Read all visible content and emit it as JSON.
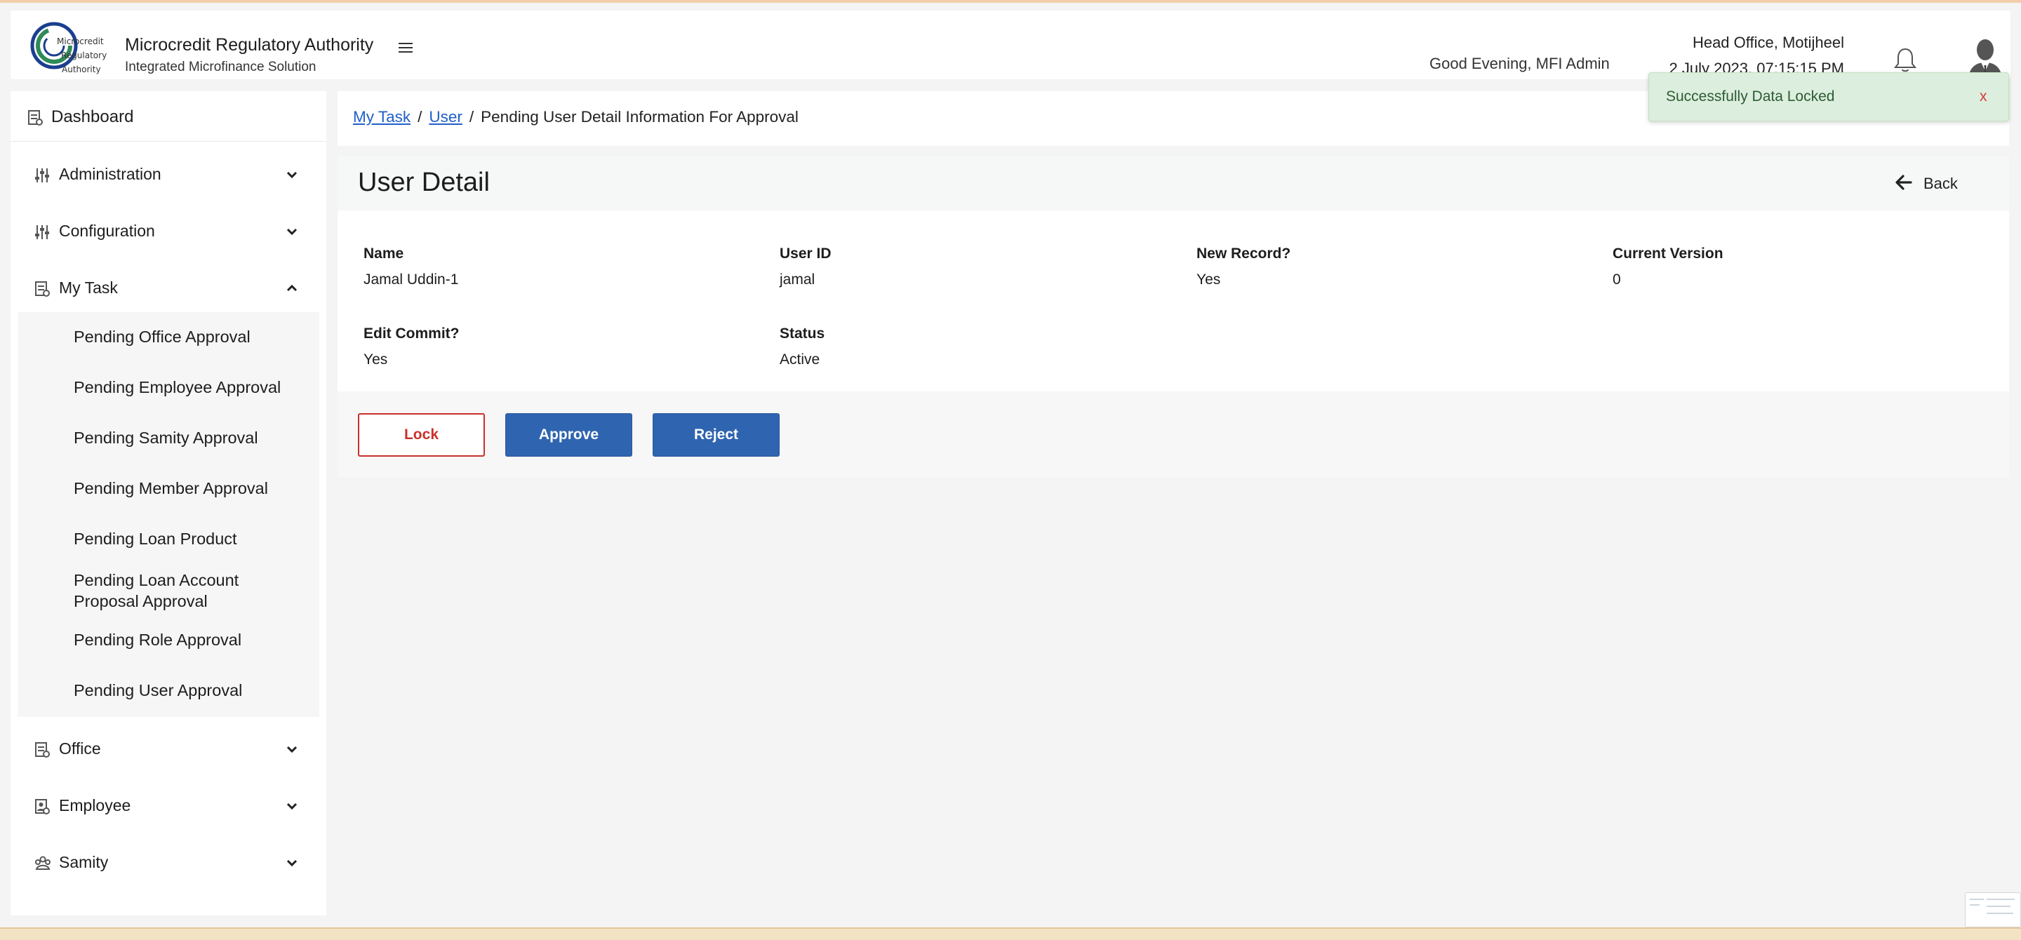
{
  "header": {
    "org_name": "Microcredit Regulatory Authority",
    "org_subtitle": "Integrated Microfinance Solution",
    "logo_text_1": "Microcredit",
    "logo_text_2": "Regulatory",
    "logo_text_3": "Authority",
    "greeting": "Good Evening, MFI Admin",
    "office": "Head Office, Motijheel",
    "datetime": "2 July 2023, 07:15:15 PM"
  },
  "sidebar": {
    "dashboard": "Dashboard",
    "items": [
      {
        "label": "Administration",
        "icon": "sliders-icon",
        "expanded": false
      },
      {
        "label": "Configuration",
        "icon": "sliders-icon",
        "expanded": false
      },
      {
        "label": "My Task",
        "icon": "task-icon",
        "expanded": true
      },
      {
        "label": "Office",
        "icon": "office-icon",
        "expanded": false
      },
      {
        "label": "Employee",
        "icon": "employee-icon",
        "expanded": false
      },
      {
        "label": "Samity",
        "icon": "samity-icon",
        "expanded": false
      }
    ],
    "my_task_sub": [
      "Pending Office Approval",
      "Pending Employee Approval",
      "Pending Samity Approval",
      "Pending Member Approval",
      "Pending Loan Product",
      "Pending Loan Account Proposal Approval",
      "Pending Role Approval",
      "Pending User Approval"
    ]
  },
  "breadcrumb": {
    "items": [
      "My Task",
      "User"
    ],
    "current": "Pending User Detail Information For Approval",
    "separator": "/"
  },
  "detail": {
    "title": "User Detail",
    "back_label": "Back",
    "fields": [
      {
        "label": "Name",
        "value": "Jamal Uddin-1"
      },
      {
        "label": "User ID",
        "value": "jamal"
      },
      {
        "label": "New Record?",
        "value": "Yes"
      },
      {
        "label": "Current Version",
        "value": "0"
      },
      {
        "label": "Edit Commit?",
        "value": "Yes"
      },
      {
        "label": "Status",
        "value": "Active"
      }
    ]
  },
  "actions": {
    "lock": "Lock",
    "approve": "Approve",
    "reject": "Reject"
  },
  "toast": {
    "message": "Successfully Data Locked",
    "close": "x"
  },
  "colors": {
    "primary": "#2f64b0",
    "danger": "#c9302c",
    "toast_bg": "#dceedd",
    "logo_green": "#2e8b57",
    "logo_blue": "#1a3f8f"
  }
}
